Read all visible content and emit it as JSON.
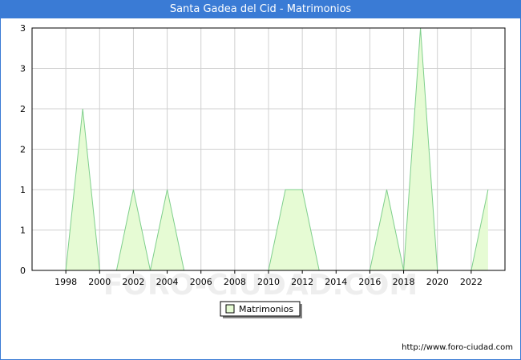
{
  "title": "Santa Gadea del Cid - Matrimonios",
  "footer_url": "http://www.foro-ciudad.com",
  "watermark": "FORO-CIUDAD.COM",
  "colors": {
    "title_bar": "#3a7bd5",
    "area_fill": "#e6fbd4",
    "area_line": "#7fcf8c",
    "grid": "#d0d0d0"
  },
  "chart_data": {
    "type": "area",
    "title": "Santa Gadea del Cid - Matrimonios",
    "x": [
      1998,
      1999,
      2000,
      2001,
      2002,
      2003,
      2004,
      2005,
      2006,
      2007,
      2008,
      2009,
      2010,
      2011,
      2012,
      2013,
      2014,
      2015,
      2016,
      2017,
      2018,
      2019,
      2020,
      2021,
      2022,
      2023
    ],
    "series": [
      {
        "name": "Matrimonios",
        "values": [
          0,
          2,
          0,
          0,
          1,
          0,
          1,
          0,
          0,
          0,
          0,
          0,
          0,
          1,
          1,
          0,
          0,
          0,
          0,
          1,
          0,
          3,
          0,
          0,
          0,
          1
        ]
      }
    ],
    "x_tick_labels": [
      "1998",
      "2000",
      "2002",
      "2004",
      "2006",
      "2008",
      "2010",
      "2012",
      "2014",
      "2016",
      "2018",
      "2020",
      "2022"
    ],
    "y_tick_labels": [
      "0",
      "1",
      "1",
      "2",
      "2",
      "3",
      "3"
    ],
    "xlim": [
      1996,
      2024
    ],
    "ylim": [
      0,
      3
    ],
    "grid": true,
    "legend_position": "bottom-center"
  }
}
